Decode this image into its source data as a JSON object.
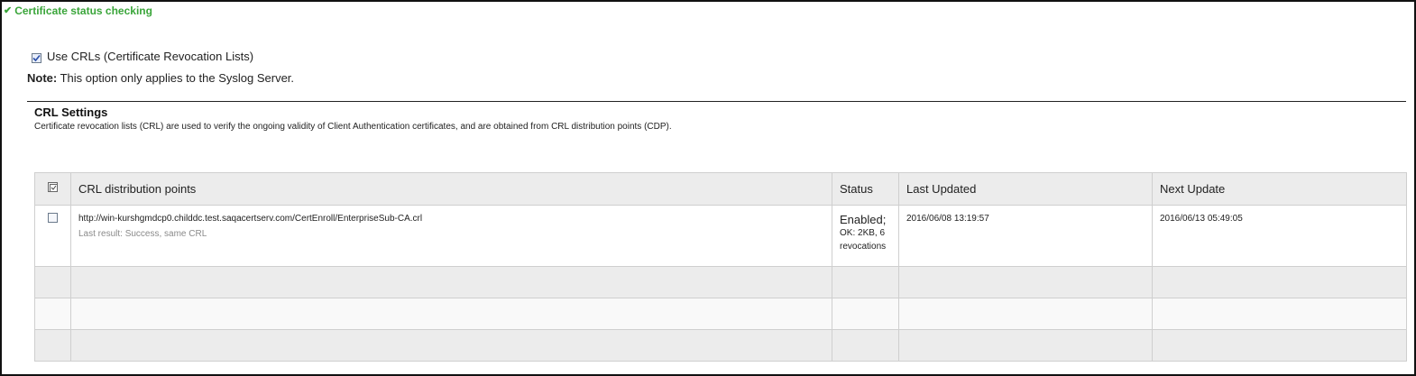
{
  "section": {
    "title": "Certificate status checking",
    "checkmark": "✔"
  },
  "crl_option": {
    "label": "Use CRLs (Certificate Revocation Lists)",
    "checked": true
  },
  "note": {
    "prefix": "Note:",
    "text": " This option only applies to the Syslog Server."
  },
  "crl_settings": {
    "title": "CRL Settings",
    "description": "Certificate revocation lists (CRL) are used to verify the ongoing validity of Client Authentication certificates, and are obtained from CRL distribution points (CDP)."
  },
  "table": {
    "headers": {
      "select_all_icon": "select-all-icon",
      "cdp": "CRL distribution points",
      "status": "Status",
      "last_updated": "Last Updated",
      "next_update": "Next Update"
    },
    "rows": [
      {
        "url": "http://win-kurshgmdcp0.childdc.test.saqacertserv.com/CertEnroll/EnterpriseSub-CA.crl",
        "last_result": "Last result: Success, same CRL",
        "status_main": "Enabled;",
        "status_line2": "OK: 2KB, 6",
        "status_line3": "revocations",
        "last_updated": "2016/06/08 13:19:57",
        "next_update": "2016/06/13 05:49:05",
        "selected": false
      }
    ]
  }
}
